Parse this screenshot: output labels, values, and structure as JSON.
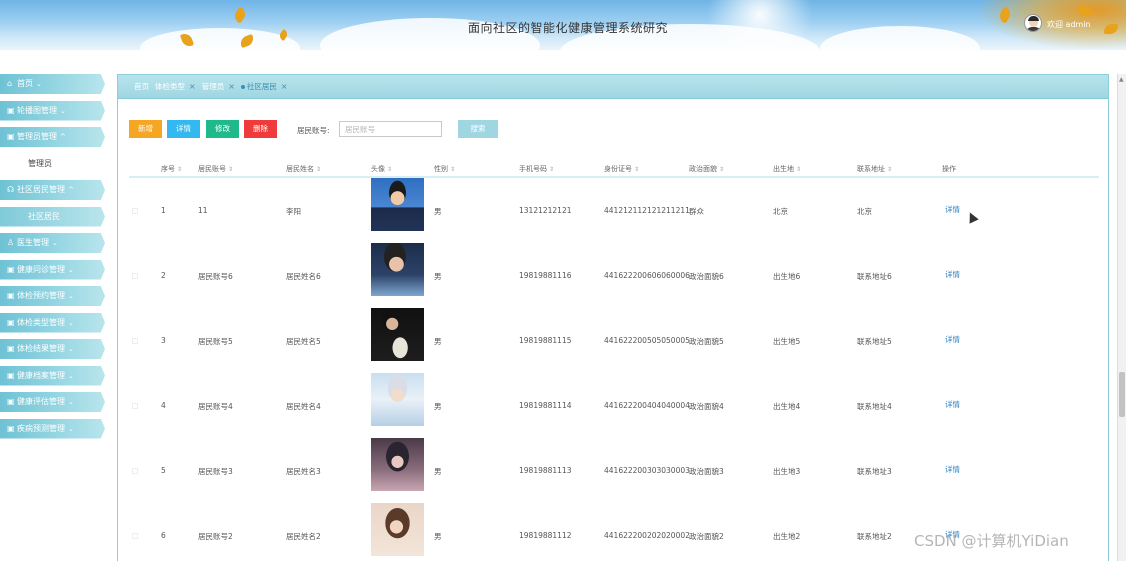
{
  "header": {
    "title": "面向社区的智能化健康管理系统研究",
    "welcome": "欢迎 admin"
  },
  "sidebar": {
    "items": [
      {
        "label": "首页",
        "icon": "home-icon",
        "chevron": "⌄"
      },
      {
        "label": "轮播图管理",
        "icon": "image-icon",
        "chevron": "⌄"
      },
      {
        "label": "管理员管理",
        "icon": "admin-icon",
        "chevron": "^"
      },
      {
        "label": "管理员",
        "sub": true
      },
      {
        "label": "社区居民管理",
        "icon": "users-icon",
        "chevron": "^"
      },
      {
        "label": "社区居民",
        "sub": true,
        "active": true
      },
      {
        "label": "医生管理",
        "icon": "doctor-icon",
        "chevron": "⌄"
      },
      {
        "label": "健康问诊管理",
        "icon": "consult-icon",
        "chevron": "⌄"
      },
      {
        "label": "体检预约管理",
        "icon": "calendar-icon",
        "chevron": "⌄"
      },
      {
        "label": "体检类型管理",
        "icon": "list-icon",
        "chevron": "⌄"
      },
      {
        "label": "体检结果管理",
        "icon": "report-icon",
        "chevron": "⌄"
      },
      {
        "label": "健康档案管理",
        "icon": "folder-icon",
        "chevron": "⌄"
      },
      {
        "label": "健康评估管理",
        "icon": "chart-icon",
        "chevron": "⌄"
      },
      {
        "label": "疾病预测管理",
        "icon": "predict-icon",
        "chevron": "⌄"
      }
    ]
  },
  "tabs": [
    {
      "label": "首页",
      "closable": false
    },
    {
      "label": "体检类型",
      "closable": true
    },
    {
      "label": "管理员",
      "closable": true
    },
    {
      "label": "社区居民",
      "closable": true,
      "active": true
    }
  ],
  "toolbar": {
    "add": "新增",
    "detail": "详情",
    "edit": "修改",
    "delete": "删除",
    "search_label": "居民账号:",
    "search_placeholder": "居民账号",
    "search_button": "搜索"
  },
  "table": {
    "columns": [
      "序号",
      "居民账号",
      "居民姓名",
      "头像",
      "性别",
      "手机号码",
      "身份证号",
      "政治面貌",
      "出生地",
      "联系地址",
      "操作"
    ],
    "rows": [
      {
        "no": "1",
        "account": "11",
        "name": "李阳",
        "gender": "男",
        "phone": "13121212121",
        "idcard": "441212112121211211",
        "political": "群众",
        "birthplace": "北京",
        "address": "北京",
        "action": "详情",
        "photo": "avatar-man-suit"
      },
      {
        "no": "2",
        "account": "居民账号6",
        "name": "居民姓名6",
        "gender": "男",
        "phone": "19819881116",
        "idcard": "441622200606060006",
        "political": "政治面貌6",
        "birthplace": "出生地6",
        "address": "联系地址6",
        "action": "详情",
        "photo": "avatar-young-man"
      },
      {
        "no": "3",
        "account": "居民账号5",
        "name": "居民姓名5",
        "gender": "男",
        "phone": "19819881115",
        "idcard": "441622200505050005",
        "political": "政治面貌5",
        "birthplace": "出生地5",
        "address": "联系地址5",
        "action": "详情",
        "photo": "avatar-reading"
      },
      {
        "no": "4",
        "account": "居民账号4",
        "name": "居民姓名4",
        "gender": "男",
        "phone": "19819881114",
        "idcard": "441622200404040004",
        "political": "政治面貌4",
        "birthplace": "出生地4",
        "address": "联系地址4",
        "action": "详情",
        "photo": "avatar-girl-white"
      },
      {
        "no": "5",
        "account": "居民账号3",
        "name": "居民姓名3",
        "gender": "男",
        "phone": "19819881113",
        "idcard": "441622200303030003",
        "political": "政治面貌3",
        "birthplace": "出生地3",
        "address": "联系地址3",
        "action": "详情",
        "photo": "avatar-girl-dark"
      },
      {
        "no": "6",
        "account": "居民账号2",
        "name": "居民姓名2",
        "gender": "男",
        "phone": "19819881112",
        "idcard": "441622200202020002",
        "political": "政治面貌2",
        "birthplace": "出生地2",
        "address": "联系地址2",
        "action": "详情",
        "photo": "avatar-girl-hair"
      }
    ]
  },
  "watermark": "CSDN @计算机YiDian"
}
